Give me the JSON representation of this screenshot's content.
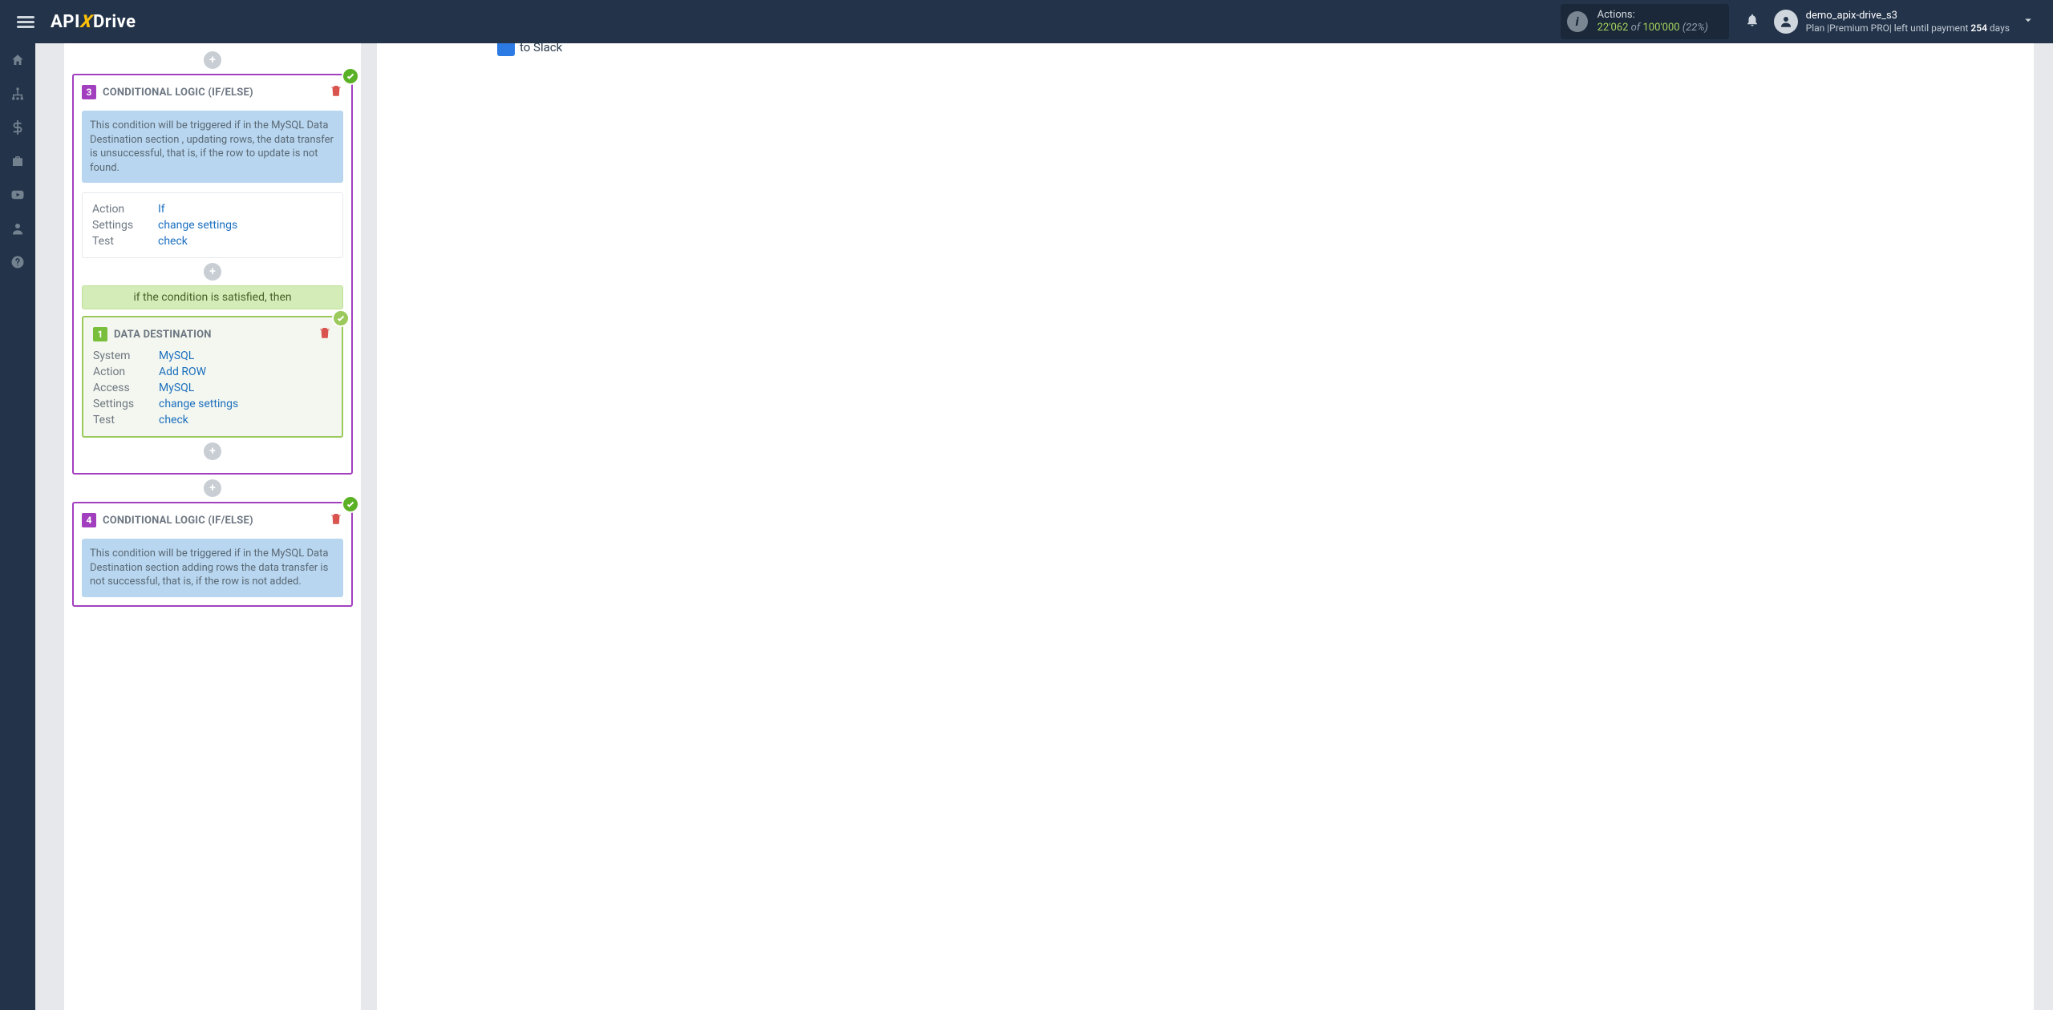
{
  "header": {
    "logo_prefix": "API",
    "logo_x": "X",
    "logo_suffix": "Drive",
    "actions_label": "Actions:",
    "actions_used": "22'062",
    "actions_of": "of",
    "actions_total": "100'000",
    "actions_pct": "(22%)",
    "user_name": "demo_apix-drive_s3",
    "plan_prefix": "Plan |Premium PRO| left until payment ",
    "plan_days_value": "254",
    "plan_suffix": " days"
  },
  "rail": {
    "items_names": [
      "home",
      "sitemap",
      "billing",
      "briefcase",
      "youtube",
      "profile",
      "help"
    ]
  },
  "right": {
    "partial_text": "to Slack"
  },
  "step3": {
    "num": "3",
    "title": "CONDITIONAL LOGIC (IF/ELSE)",
    "note": "This condition will be triggered if in the MySQL Data Destination section , updating rows, the data transfer is unsuccessful, that is, if the row to update is not found.",
    "rows": {
      "action_k": "Action",
      "action_v": "If",
      "settings_k": "Settings",
      "settings_v": "change settings",
      "test_k": "Test",
      "test_v": "check"
    },
    "cond_banner": "if the condition is satisfied, then",
    "dest": {
      "num": "1",
      "title": "DATA DESTINATION",
      "rows": {
        "system_k": "System",
        "system_v": "MySQL",
        "action_k": "Action",
        "action_v": "Add ROW",
        "access_k": "Access",
        "access_v": "MySQL",
        "settings_k": "Settings",
        "settings_v": "change settings",
        "test_k": "Test",
        "test_v": "check"
      }
    }
  },
  "step4": {
    "num": "4",
    "title": "CONDITIONAL LOGIC (IF/ELSE)",
    "note": "This condition will be triggered if in the MySQL Data Destination section adding rows the data transfer is not successful, that is, if the row is not added."
  }
}
